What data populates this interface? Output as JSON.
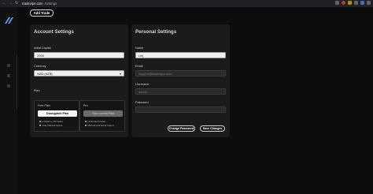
{
  "browser": {
    "host": "tradevipe.com",
    "path": "/settings"
  },
  "toolbar": {
    "add_trade": "Add Trade"
  },
  "account": {
    "title": "Account Settings",
    "initial_capital_label": "Initial Capital",
    "initial_capital_value": "2000",
    "currency_label": "Currency",
    "currency_value": "NZD (NZ$)",
    "plan_label": "Plan",
    "free_plan": {
      "name": "Free Plan",
      "button": "Downgrade Plan",
      "features": [
        "Limited to 10 trades",
        "Only Manual Inputs"
      ]
    },
    "pro_plan": {
      "name": "Pro",
      "button": "Your current Plan",
      "features": [
        "Unlimited Trades",
        "Manual and Excel Import"
      ]
    }
  },
  "personal": {
    "title": "Personal Settings",
    "name_label": "Name",
    "name_value": "Lin|",
    "email_label": "Email",
    "email_value": "support@tradevipe.com",
    "username_label": "Username",
    "username_value": "admin",
    "password_label": "Password",
    "password_value": "",
    "change_password": "Change Password",
    "save_changes": "Save Changes"
  },
  "colors": {
    "background": "#0d0d0d",
    "card": "#1b1b1b",
    "accent": "#3b6fb6"
  }
}
